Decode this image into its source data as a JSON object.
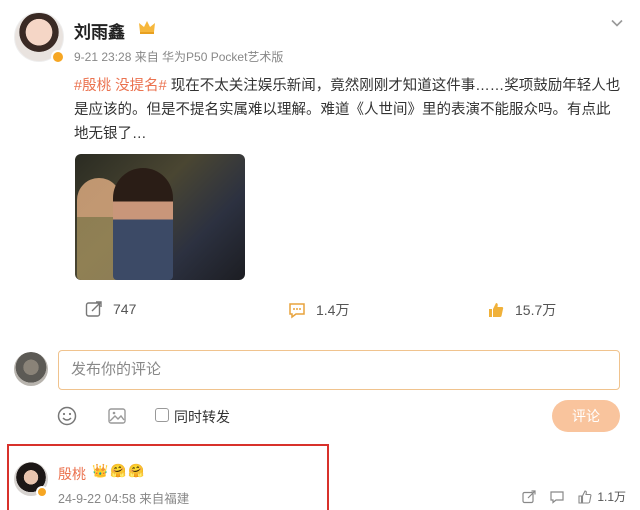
{
  "post": {
    "author": "刘雨鑫",
    "meta": "9-21 23:28  来自 华为P50 Pocket艺术版",
    "topic": "#殷桃 没提名#",
    "body": " 现在不太关注娱乐新闻，竟然刚刚才知道这件事……奖项鼓励年轻人也是应该的。但是不提名实属难以理解。难道《人世间》里的表演不能服众吗。有点此地无银了…"
  },
  "actions": {
    "share_count": "747",
    "comment_count": "1.4万",
    "like_count": "15.7万"
  },
  "comment_box": {
    "placeholder": "发布你的评论",
    "repost_label": "同时转发",
    "submit_label": "评论"
  },
  "reply": {
    "name": "殷桃",
    "emojis": "👑🤗🤗",
    "meta": "24-9-22 04:58 来自福建",
    "like_count": "1.1万"
  },
  "colors": {
    "accent": "#eb7350",
    "highlight": "#d8312b",
    "submit_bg": "#f9c49d",
    "input_border": "#f0c38e"
  }
}
